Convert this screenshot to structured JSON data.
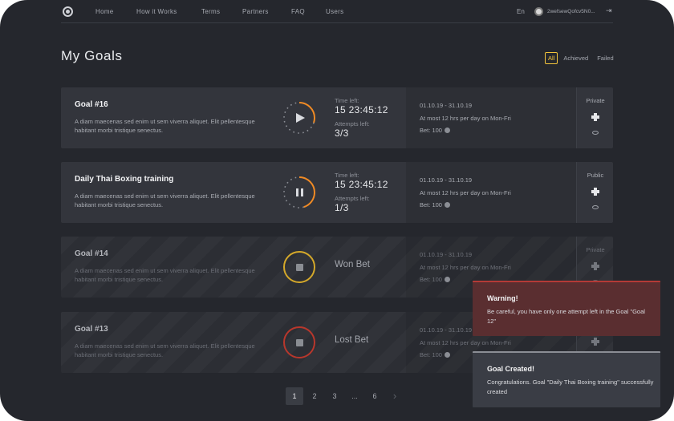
{
  "nav": {
    "links": [
      "Home",
      "How it Works",
      "Terms",
      "Partners",
      "FAQ",
      "Users"
    ],
    "language": "En",
    "user_name": "2wefsewQofcv5N0..."
  },
  "page_title": "My Goals",
  "filters": [
    "All",
    "Achieved",
    "Failed"
  ],
  "active_filter": "All",
  "goals": [
    {
      "title": "Goal #16",
      "description": "A diam maecenas sed enim ut sem viverra aliquet. Elit pellentesque habitant morbi tristique senectus.",
      "state": "paused",
      "control_icon": "play-icon",
      "progress": 0.3,
      "ring_color": "#f08a24",
      "time_left_label": "Time left:",
      "time_left": "15 23:45:12",
      "attempts_label": "Attempts left:",
      "attempts": "3/3",
      "dates": "01.10.19 - 31.10.19",
      "schedule": "At most 12 hrs per day on Mon-Fri",
      "bet_label": "Bet:",
      "bet": "100",
      "visibility": "Private"
    },
    {
      "title": "Daily Thai Boxing training",
      "description": "A diam maecenas sed enim ut sem viverra aliquet. Elit pellentesque habitant morbi tristique senectus.",
      "state": "running",
      "control_icon": "pause-icon",
      "progress": 0.45,
      "ring_color": "#f08a24",
      "time_left_label": "Time left:",
      "time_left": "15 23:45:12",
      "attempts_label": "Attempts left:",
      "attempts": "1/3",
      "dates": "01.10.19 - 31.10.19",
      "schedule": "At most 12 hrs per day on Mon-Fri",
      "bet_label": "Bet:",
      "bet": "100",
      "visibility": "Public"
    },
    {
      "title": "Goal #14",
      "description": "A diam maecenas sed enim ut sem viverra aliquet. Elit pellentesque habitant morbi tristique senectus.",
      "state": "won",
      "control_icon": "stop-icon",
      "progress": 1,
      "ring_color": "#d4a82a",
      "result": "Won Bet",
      "dates": "01.10.19 - 31.10.19",
      "schedule": "At most 12 hrs per day on Mon-Fri",
      "bet_label": "Bet:",
      "bet": "100",
      "visibility": "Private"
    },
    {
      "title": "Goal #13",
      "description": "A diam maecenas sed enim ut sem viverra aliquet. Elit pellentesque habitant morbi tristique senectus.",
      "state": "lost",
      "control_icon": "stop-icon",
      "progress": 1,
      "ring_color": "#b8372c",
      "result": "Lost Bet",
      "dates": "01.10.19 - 31.10.19",
      "schedule": "At most 12 hrs per day on Mon-Fri",
      "bet_label": "Bet:",
      "bet": "100",
      "visibility": ""
    }
  ],
  "pagination": {
    "pages": [
      "1",
      "2",
      "3",
      "...",
      "6"
    ],
    "current": "1"
  },
  "toasts": {
    "warning": {
      "title": "Warning!",
      "body": "Be careful, you have only one attempt left in the Goal \"Goal 12\""
    },
    "success": {
      "title": "Goal Created!",
      "body": "Congratulations. Goal \"Daily Thai Boxing training\" successfully created"
    }
  },
  "colors": {
    "background": "#25272d",
    "card": "#33353c",
    "accent": "#f3c43b",
    "progress": "#f08a24",
    "warning": "#5a2e30"
  }
}
